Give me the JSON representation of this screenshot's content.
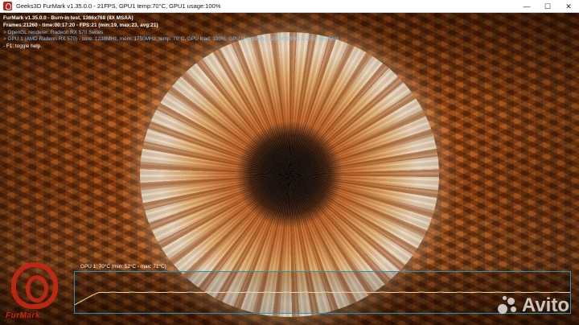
{
  "window": {
    "title": "Geeks3D FurMark v1.35.0.0 - 21FPS, GPU1 temp:70°C, GPU1 usage:100%",
    "controls": [
      "—",
      "☐",
      "✕"
    ]
  },
  "osd": {
    "title_line": "FurMark v1.35.0.0 - Burn-in test, 1366x768 (8X MSAA)",
    "frames_line": "Frames:21260 - time:00:17:20 - FPS:21 (min:19, max:23, avg:21)",
    "renderer_line": "> OpenGL renderer: Radeon RX 570 Series",
    "gpu_line": "> GPU 1 (AMD Radeon RX 570) - core: 1238MHz, mem: 1750MHz, temp: 70°C, GPU load: 100%, GPU chip power: 128 W (PPW: 0.176), fan: 56%",
    "help_line": "- F1: toggle help"
  },
  "graph": {
    "label": "GPU 1: 70°C (min: 52°C - max: 71°C)",
    "current_temp": 70,
    "min_temp": 52,
    "max_temp": 71,
    "line_color": "#f0d8a0"
  },
  "logo": {
    "text": "FurMark"
  },
  "watermark": {
    "text": "Avito"
  },
  "colors": {
    "osd_gpu": "#7fc7ff",
    "graph_border": "#2a8fb0",
    "logo_red": "#c8281a"
  }
}
